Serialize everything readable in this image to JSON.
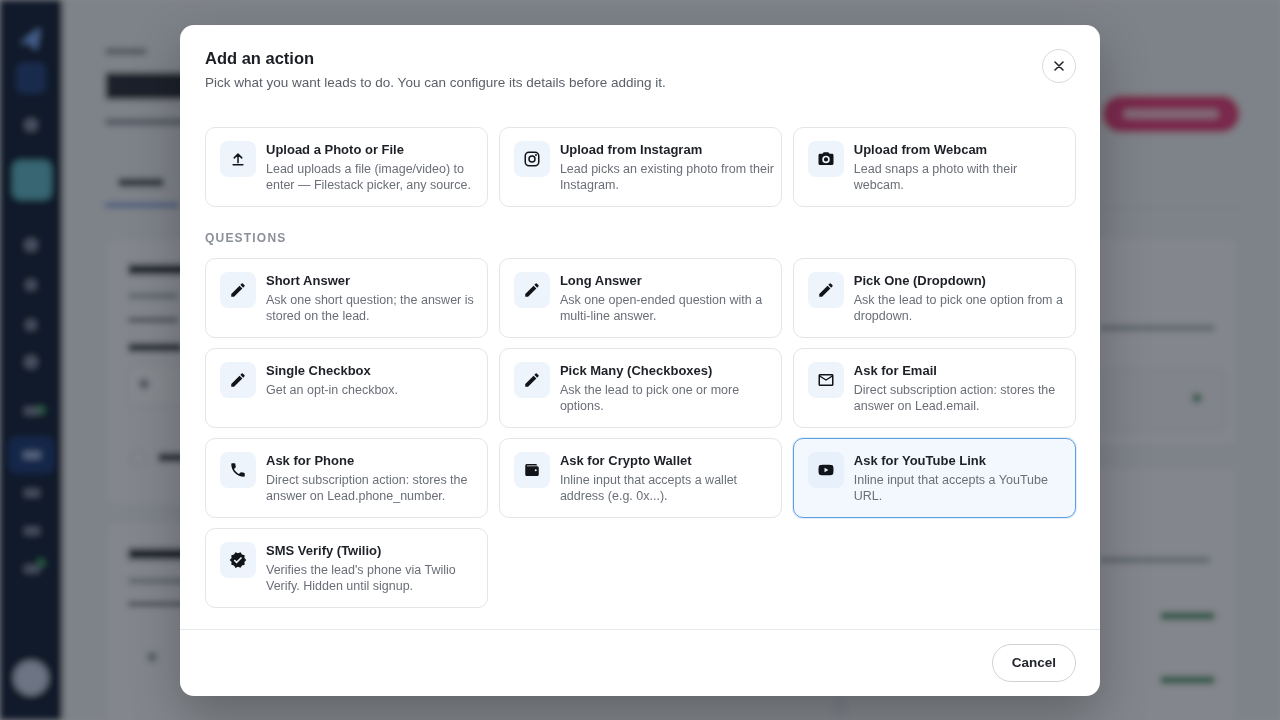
{
  "dialog": {
    "title": "Add an action",
    "subtitle": "Pick what you want leads to do. You can configure its details before adding it."
  },
  "sections": [
    {
      "items": [
        {
          "kind": "file_upload",
          "title": "Upload a Photo or File",
          "description": "Lead uploads a file (image/video) to enter — Filestack picker, any source.",
          "selected": false
        },
        {
          "kind": "instagram",
          "title": "Upload from Instagram",
          "description": "Lead picks an existing photo from their Instagram.",
          "selected": false
        },
        {
          "kind": "webcam",
          "title": "Upload from Webcam",
          "description": "Lead snaps a photo with their webcam.",
          "selected": false
        }
      ]
    },
    {
      "heading": "QUESTIONS",
      "items": [
        {
          "kind": "text",
          "title": "Short Answer",
          "description": "Ask one short question; the answer is stored on the lead.",
          "selected": false
        },
        {
          "kind": "text",
          "title": "Long Answer",
          "description": "Ask one open-ended question with a multi-line answer.",
          "selected": false
        },
        {
          "kind": "text",
          "title": "Pick One (Dropdown)",
          "description": "Ask the lead to pick one option from a dropdown.",
          "selected": false
        },
        {
          "kind": "text",
          "title": "Single Checkbox",
          "description": "Get an opt-in checkbox.",
          "selected": false
        },
        {
          "kind": "text",
          "title": "Pick Many (Checkboxes)",
          "description": "Ask the lead to pick one or more options.",
          "selected": false
        },
        {
          "kind": "email",
          "title": "Ask for Email",
          "description": "Direct subscription action: stores the answer on Lead.email.",
          "selected": false
        },
        {
          "kind": "phone",
          "title": "Ask for Phone",
          "description": "Direct subscription action: stores the answer on Lead.phone_number.",
          "selected": false
        },
        {
          "kind": "wallet",
          "title": "Ask for Crypto Wallet",
          "description": "Inline input that accepts a wallet address (e.g. 0x...).",
          "selected": false
        },
        {
          "kind": "youtube",
          "title": "Ask for YouTube Link",
          "description": "Inline input that accepts a YouTube URL.",
          "selected": true
        },
        {
          "kind": "verify",
          "title": "SMS Verify (Twilio)",
          "description": "Verifies the lead's phone via Twilio Verify. Hidden until signup.",
          "selected": false
        }
      ]
    }
  ],
  "footer": {
    "cancel_button": "Cancel"
  }
}
